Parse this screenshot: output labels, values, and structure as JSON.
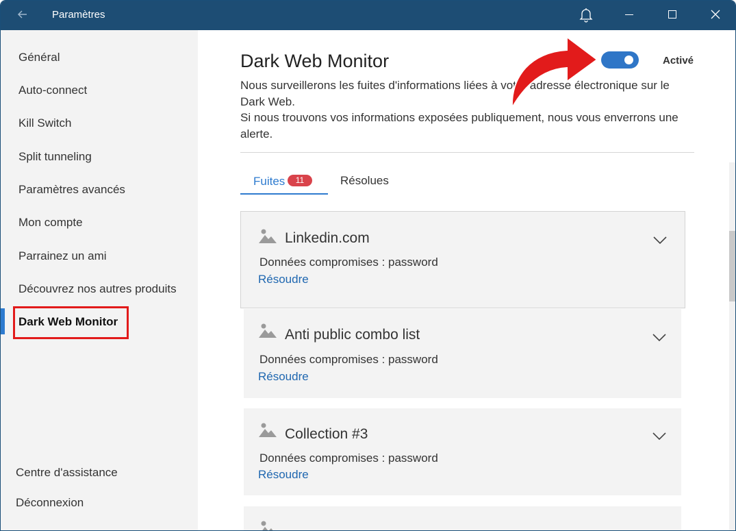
{
  "titlebar": {
    "title": "Paramètres"
  },
  "sidebar": {
    "items": [
      {
        "label": "Général"
      },
      {
        "label": "Auto-connect"
      },
      {
        "label": "Kill Switch"
      },
      {
        "label": "Split tunneling"
      },
      {
        "label": "Paramètres avancés"
      },
      {
        "label": "Mon compte"
      },
      {
        "label": "Parrainez un ami"
      },
      {
        "label": "Découvrez nos autres produits"
      },
      {
        "label": "Dark Web Monitor"
      }
    ],
    "bottom": [
      {
        "label": "Centre d'assistance"
      },
      {
        "label": "Déconnexion"
      }
    ]
  },
  "main": {
    "title": "Dark Web Monitor",
    "toggle": {
      "state": "on",
      "label": "Activé"
    },
    "description": [
      "Nous surveillerons les fuites d'informations liées à votre adresse électronique sur le Dark Web.",
      "Si nous trouvons vos informations exposées publiquement, nous vous enverrons une alerte."
    ],
    "tabs": [
      {
        "label": "Fuites",
        "badge": "11"
      },
      {
        "label": "Résolues"
      }
    ],
    "breaches": [
      {
        "name": "Linkedin.com",
        "data": "Données compromises : password",
        "action": "Résoudre"
      },
      {
        "name": "Anti public combo list",
        "data": "Données compromises : password",
        "action": "Résoudre"
      },
      {
        "name": "Collection #3",
        "data": "Données compromises : password",
        "action": "Résoudre"
      }
    ]
  },
  "colors": {
    "titlebar": "#1d4d74",
    "accent": "#2e7bcf",
    "link": "#1f67b0",
    "badge": "#d9434b",
    "annotation": "#e21b1b"
  }
}
